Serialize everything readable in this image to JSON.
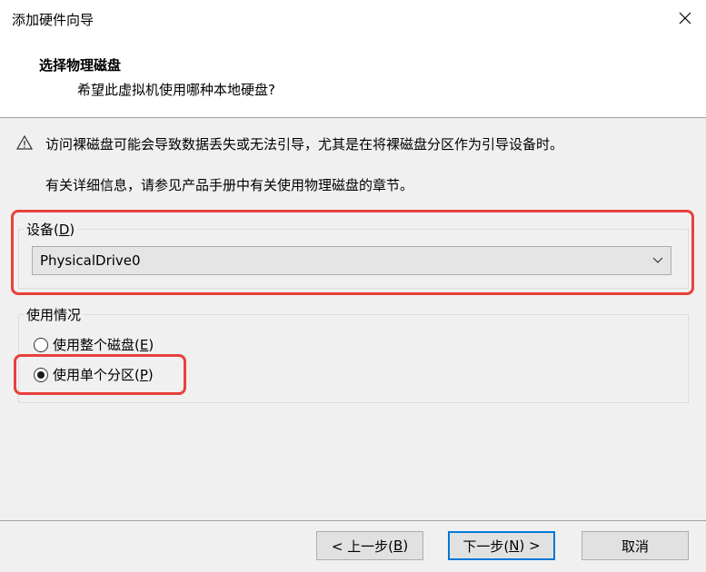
{
  "window": {
    "title": "添加硬件向导",
    "close_glyph": "✕"
  },
  "header": {
    "title": "选择物理磁盘",
    "subtitle": "希望此虚拟机使用哪种本地硬盘?"
  },
  "warning": {
    "icon": "warning-triangle-icon",
    "icon_glyph": "⚠",
    "text": "访问裸磁盘可能会导致数据丢失或无法引导，尤其是在将裸磁盘分区作为引导设备时。"
  },
  "info_text": "有关详细信息，请参见产品手册中有关使用物理磁盘的章节。",
  "device_group": {
    "label_prefix": "设备(",
    "label_key": "D",
    "label_suffix": ")",
    "selected": "PhysicalDrive0"
  },
  "usage_group": {
    "label": "使用情况",
    "options": [
      {
        "prefix": "使用整个磁盘(",
        "key": "E",
        "suffix": ")",
        "checked": false
      },
      {
        "prefix": "使用单个分区(",
        "key": "P",
        "suffix": ")",
        "checked": true
      }
    ]
  },
  "buttons": {
    "back": {
      "prefix": "< 上一步(",
      "key": "B",
      "suffix": ")"
    },
    "next": {
      "prefix": "下一步(",
      "key": "N",
      "suffix": ") >"
    },
    "cancel": "取消"
  },
  "colors": {
    "highlight": "#e8413d",
    "default_button_border": "#0078d7"
  }
}
